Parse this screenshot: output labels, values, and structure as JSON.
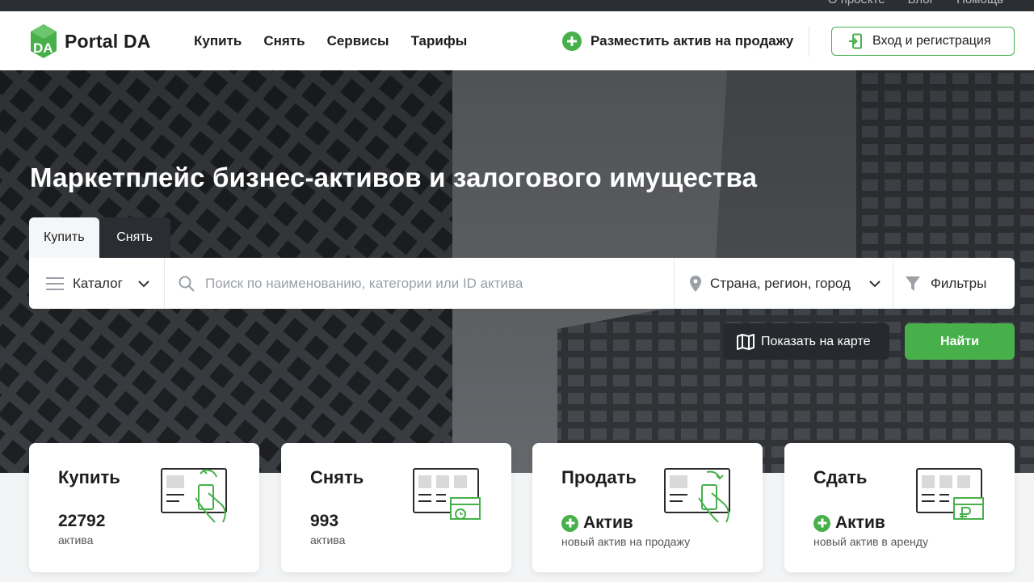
{
  "topbar": {
    "links": [
      "О проекте",
      "Блог",
      "Помощь"
    ]
  },
  "header": {
    "brand": "Portal DA",
    "nav": [
      "Купить",
      "Снять",
      "Сервисы",
      "Тарифы"
    ],
    "place_asset": "Разместить актив на продажу",
    "login": "Вход и регистрация"
  },
  "hero": {
    "title": "Маркетплейс бизнес-активов и залогового имущества",
    "tabs": [
      {
        "label": "Купить",
        "active": true
      },
      {
        "label": "Снять",
        "active": false
      }
    ],
    "search": {
      "catalog": "Каталог",
      "placeholder": "Поиск по наименованию, категории или ID актива",
      "region": "Страна, регион, город",
      "filters": "Фильтры"
    },
    "map_button": "Показать на карте",
    "find_button": "Найти"
  },
  "cards": [
    {
      "title": "Купить",
      "count": "22792",
      "unit": "актива"
    },
    {
      "title": "Снять",
      "count": "993",
      "unit": "актива"
    },
    {
      "title": "Продать",
      "action": "Актив",
      "sub": "новый актив на продажу"
    },
    {
      "title": "Сдать",
      "action": "Актив",
      "sub": "новый актив в аренду"
    }
  ],
  "colors": {
    "accent": "#47b04b",
    "dark": "#2b2f33",
    "text": "#1d1d1d"
  }
}
